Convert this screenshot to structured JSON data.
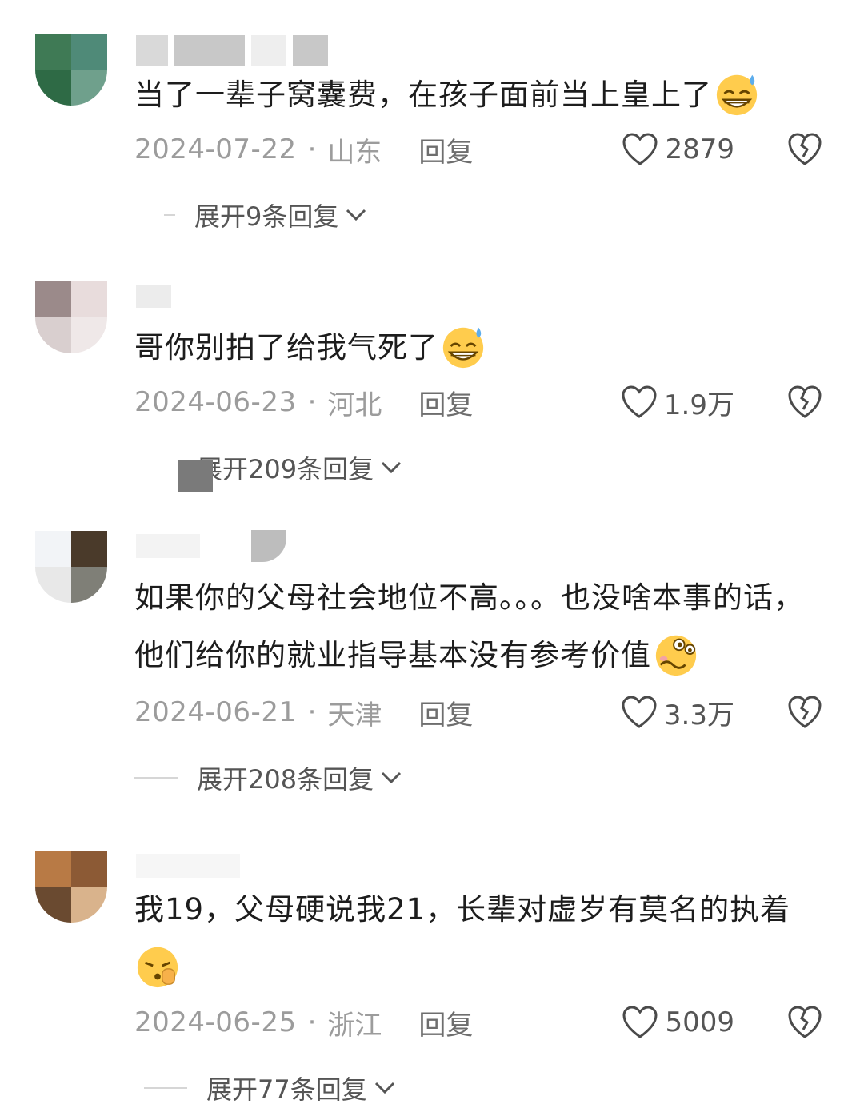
{
  "comments": [
    {
      "text": "当了一辈子窝囊费，在孩子面前当上皇上了",
      "emoji": "grin-sweat-emoji",
      "date": "2024-07-22",
      "location": "山东",
      "reply_label": "回复",
      "likes": "2879",
      "expand_label": "展开9条回复"
    },
    {
      "text": "哥你别拍了给我气死了",
      "emoji": "grin-sweat-emoji",
      "date": "2024-06-23",
      "location": "河北",
      "reply_label": "回复",
      "likes": "1.9万",
      "expand_label": "展开209条回复"
    },
    {
      "text": "如果你的父母社会地位不高。。。也没啥本事的话，他们给你的就业指导基本没有参考价值",
      "emoji": "woozy-emoji",
      "date": "2024-06-21",
      "location": "天津",
      "reply_label": "回复",
      "likes": "3.3万",
      "expand_label": "展开208条回复"
    },
    {
      "text": "我19，父母硬说我21，长辈对虚岁有莫名的执着",
      "emoji": "shushing-emoji",
      "date": "2024-06-25",
      "location": "浙江",
      "reply_label": "回复",
      "likes": "5009",
      "expand_label": "展开77条回复"
    }
  ],
  "separator": "·",
  "colors": {
    "background": "#ffffff",
    "text": "#1d1d1d",
    "meta": "#9c9c9c",
    "reply": "#6e6e6e",
    "icon": "#4a4a4a"
  }
}
